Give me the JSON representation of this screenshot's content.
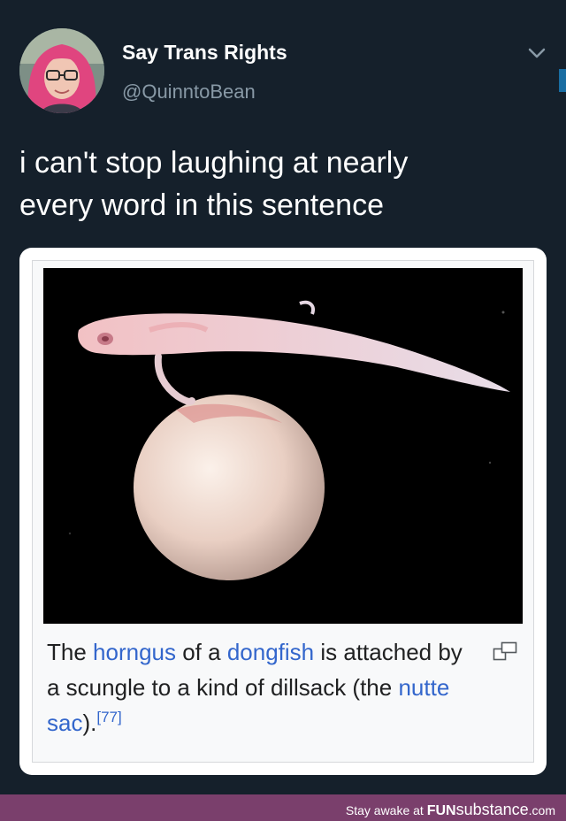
{
  "tweet": {
    "display_name": "Say Trans Rights",
    "handle": "@QuinntoBean",
    "text": "i can't stop laughing at nearly\nevery word in this sentence"
  },
  "card": {
    "caption": {
      "p1": "The ",
      "link1": "horngus",
      "p2": " of a ",
      "link2": "dongfish",
      "p3": " is attached by a scungle to a kind of dillsack (the ",
      "link3": "nutte sac",
      "p4": ").",
      "ref": "[77]"
    },
    "icons": {
      "enlarge": "enlarge-icon"
    }
  },
  "footer": {
    "prefix": "Stay awake at ",
    "brand_fun": "FUN",
    "brand_substance": "substance",
    "brand_tld": ".com"
  },
  "colors": {
    "background": "#15202b",
    "link": "#3366cc",
    "footer": "#7a3f6c"
  }
}
